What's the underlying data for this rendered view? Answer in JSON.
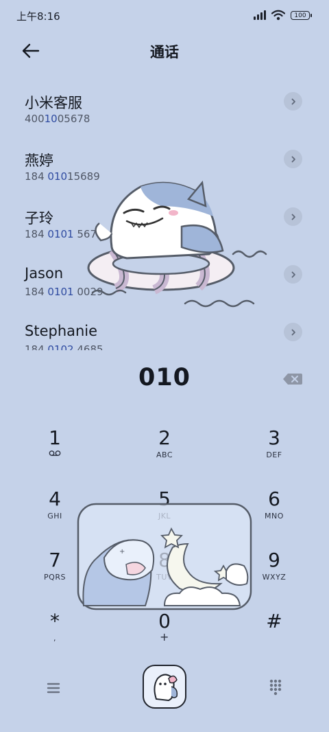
{
  "status": {
    "time": "上午8:16",
    "battery": "100"
  },
  "header": {
    "title": "通话"
  },
  "contacts": [
    {
      "name": "小米客服",
      "num_pre": "400",
      "num_hl": "10",
      "num_post": "05678"
    },
    {
      "name": "燕婷",
      "num_pre": "184 ",
      "num_hl": "010",
      "num_post": "15689"
    },
    {
      "name": "子玲",
      "num_pre": "184 ",
      "num_hl": "0101",
      "num_post": " 5678"
    },
    {
      "name": "Jason",
      "num_pre": "184 ",
      "num_hl": "0101",
      "num_post": " 0029"
    },
    {
      "name": "Stephanie",
      "num_pre": "184 ",
      "num_hl": "0102",
      "num_post": " 4685"
    }
  ],
  "dialer": {
    "input": "010"
  },
  "keypad": [
    {
      "digit": "1",
      "letters": ""
    },
    {
      "digit": "2",
      "letters": "ABC"
    },
    {
      "digit": "3",
      "letters": "DEF"
    },
    {
      "digit": "4",
      "letters": "GHI"
    },
    {
      "digit": "5",
      "letters": "JKL"
    },
    {
      "digit": "6",
      "letters": "MNO"
    },
    {
      "digit": "7",
      "letters": "PQRS"
    },
    {
      "digit": "8",
      "letters": "TUV"
    },
    {
      "digit": "9",
      "letters": "WXYZ"
    },
    {
      "digit": "*",
      "letters": ","
    },
    {
      "digit": "0",
      "letters": "+"
    },
    {
      "digit": "#",
      "letters": ""
    }
  ],
  "icons": {
    "back": "arrow-left-icon",
    "chevron": "chevron-right-icon",
    "backspace": "backspace-icon",
    "voicemail": "voicemail-icon",
    "menu": "menu-icon",
    "call": "call-icon",
    "dialpad": "dialpad-icon"
  },
  "colors": {
    "background": "#c5d2e9",
    "highlight": "#2e4aa0",
    "text": "#141820"
  }
}
